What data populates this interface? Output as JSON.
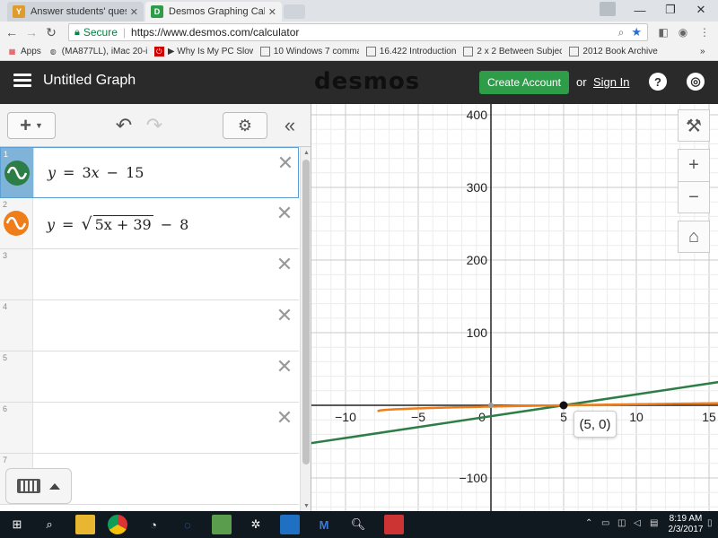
{
  "browser": {
    "tabs": [
      {
        "title": "Answer students' questio",
        "icon_color": "#e09b2d",
        "icon_letter": "Y"
      },
      {
        "title": "Desmos Graphing Calcul",
        "icon_color": "#2f9c4a",
        "icon_letter": "D"
      }
    ],
    "window_controls": [
      "—",
      "❐",
      "✕"
    ],
    "secure_label": "Secure",
    "url": "https://www.desmos.com/calculator",
    "bookmarks": [
      {
        "label": "Apps",
        "icon": "apps-grid-icon"
      },
      {
        "label": "(MA877LL), iMac 20-i",
        "icon": "site-icon"
      },
      {
        "label": "▶ Why Is My PC Slow",
        "icon": "youtube-icon"
      },
      {
        "label": "10 Windows 7 comma",
        "icon": "page-icon"
      },
      {
        "label": "16.422 Introduction",
        "icon": "page-icon"
      },
      {
        "label": "2 x 2 Between Subjec",
        "icon": "page-icon"
      },
      {
        "label": "2012 Book Archive",
        "icon": "page-icon"
      }
    ],
    "more_bookmarks": "»"
  },
  "header": {
    "graph_title": "Untitled Graph",
    "logo": "desmos",
    "create_account": "Create Account",
    "or": "or",
    "sign_in": "Sign In",
    "help_icon": "?",
    "globe_icon": "◎"
  },
  "toolbar": {
    "add": "+",
    "undo": "↶",
    "redo": "↷",
    "settings": "⚙",
    "collapse": "«"
  },
  "expressions": [
    {
      "num": "1",
      "color": "#2d7d46",
      "active": true
    },
    {
      "num": "2",
      "color": "#ee7d1a",
      "active": false
    },
    {
      "num": "3"
    },
    {
      "num": "4"
    },
    {
      "num": "5"
    },
    {
      "num": "6"
    },
    {
      "num": "7"
    }
  ],
  "expr1": {
    "y": "y",
    "eq": "=",
    "coef": "3",
    "x": "x",
    "minus": "−",
    "const": "15"
  },
  "expr2": {
    "y": "y",
    "eq": "=",
    "radical": "√",
    "radicand": "5x + 39",
    "minus": "−",
    "const": "8"
  },
  "graph": {
    "x_ticks": [
      "−10",
      "−5",
      "0",
      "5",
      "10",
      "15"
    ],
    "y_ticks": [
      "400",
      "300",
      "200",
      "100",
      "−100"
    ],
    "point_label": "(5, 0)",
    "buttons": {
      "wrench": "⚒",
      "zoom_in": "+",
      "zoom_out": "−",
      "home": "⌂"
    },
    "colors": {
      "line1": "#2d7d46",
      "line2": "#ee7d1a",
      "point": "#111111"
    }
  },
  "taskbar": {
    "time": "8:19 AM",
    "date": "2/3/2017"
  }
}
